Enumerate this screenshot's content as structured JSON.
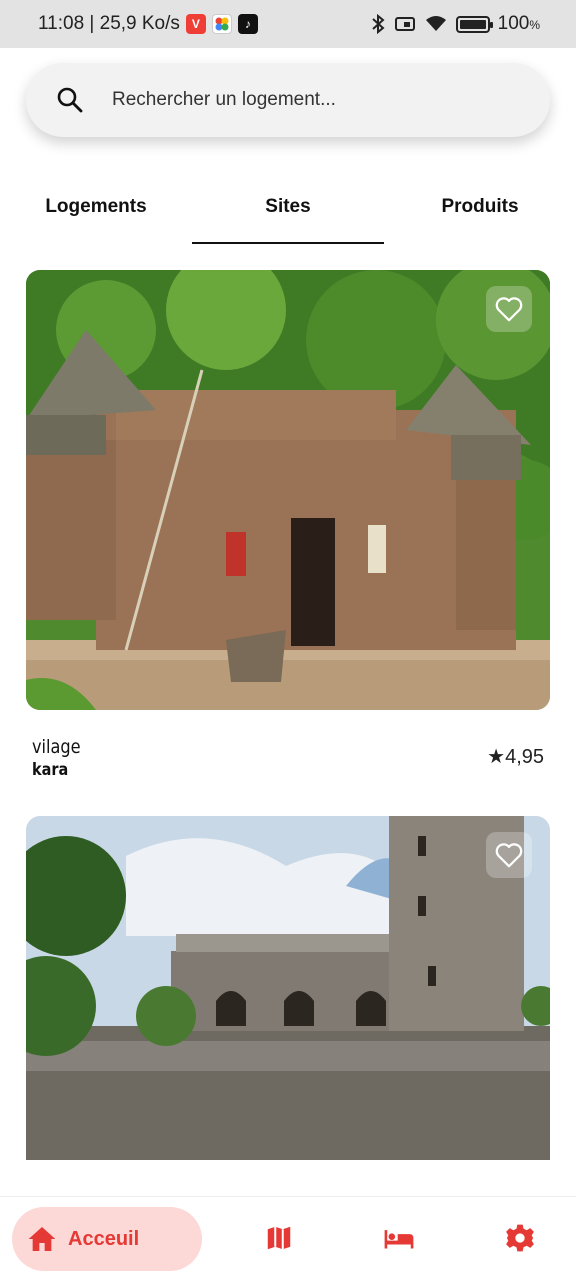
{
  "status_bar": {
    "time_info": "11:08 | 25,9 Ko/s",
    "battery": "100",
    "battery_unit": "%",
    "battery_level": 1.0
  },
  "search": {
    "placeholder": "Rechercher un logement...",
    "icon": "search-icon"
  },
  "tabs": [
    {
      "label": "Logements",
      "active": false
    },
    {
      "label": "Sites",
      "active": true
    },
    {
      "label": "Produits",
      "active": false
    }
  ],
  "cards": [
    {
      "title": "vilage",
      "subtitle": "kara",
      "rating": "★4,95",
      "favorite_icon": "heart-outline-icon"
    },
    {
      "favorite_icon": "heart-outline-icon"
    }
  ],
  "bottom_nav": {
    "home_label": "Acceuil",
    "items": [
      "home-icon",
      "map-icon",
      "bed-icon",
      "gear-icon"
    ],
    "accent": "#e53935",
    "home_bg": "#fcd8d6"
  }
}
